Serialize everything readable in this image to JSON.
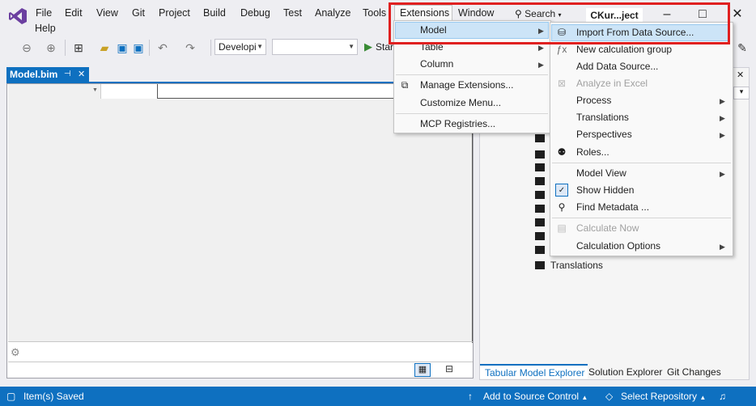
{
  "menubar": {
    "items": [
      "File",
      "Edit",
      "View",
      "Git",
      "Project",
      "Build",
      "Debug",
      "Test",
      "Analyze",
      "Tools",
      "Extensions",
      "Window",
      "Help"
    ],
    "search_label": "Search",
    "solution_name": "CKur...ject"
  },
  "toolbar": {
    "configuration": "Developi",
    "platform": "",
    "start_label": "Start"
  },
  "document": {
    "tab_title": "Model.bim",
    "pin_icon": "pin-icon",
    "close_icon": "close-icon"
  },
  "extensions_menu": {
    "items": [
      {
        "label": "Model",
        "submenu": true
      },
      {
        "label": "Table",
        "submenu": true
      },
      {
        "label": "Column",
        "submenu": true
      },
      {
        "label": "Manage Extensions...",
        "icon": "extensions-icon"
      },
      {
        "label": "Customize Menu..."
      },
      {
        "label": "MCP Registries..."
      }
    ]
  },
  "model_submenu": {
    "items": [
      {
        "label": "Import From Data Source...",
        "icon": "database-icon",
        "highlighted": true
      },
      {
        "label": "New calculation group",
        "icon": "calc-group-icon"
      },
      {
        "label": "Add Data Source...",
        "icon": "datasource-icon"
      },
      {
        "label": "Analyze in Excel",
        "icon": "excel-icon",
        "disabled": true
      },
      {
        "label": "Process",
        "submenu": true
      },
      {
        "label": "Translations",
        "submenu": true
      },
      {
        "label": "Perspectives",
        "submenu": true
      },
      {
        "label": "Roles...",
        "icon": "roles-icon"
      },
      {
        "label": "Model View",
        "submenu": true
      },
      {
        "label": "Show Hidden",
        "icon": "show-hidden-icon"
      },
      {
        "label": "Find Metadata ...",
        "icon": "find-icon"
      },
      {
        "label": "Calculate Now",
        "icon": "calculate-icon",
        "disabled": true
      },
      {
        "label": "Calculation Options",
        "submenu": true
      }
    ]
  },
  "right_panel": {
    "tree_last_item": "Translations",
    "tabs": [
      "Tabular Model Explorer",
      "Solution Explorer",
      "Git Changes"
    ],
    "active_tab": "Tabular Model Explorer"
  },
  "statusbar": {
    "left_text": "Item(s) Saved",
    "add_source_control": "Add to Source Control",
    "select_repository": "Select Repository"
  },
  "colors": {
    "accent": "#0e70c0",
    "highlight_box": "#e02020",
    "menu_highlight": "#cce4f7"
  }
}
